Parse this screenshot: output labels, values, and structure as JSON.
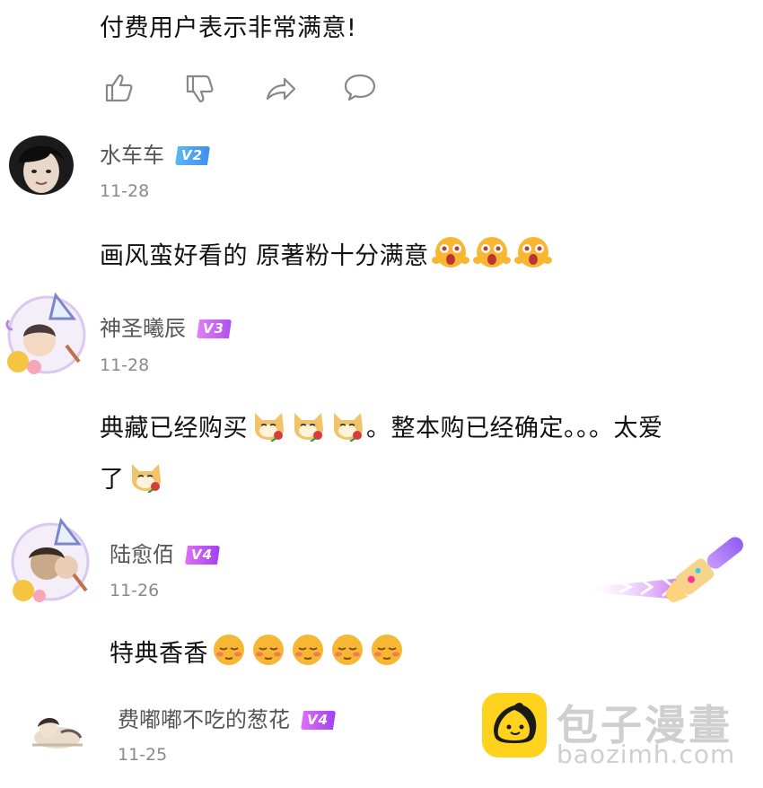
{
  "comments": [
    {
      "text": "付费用户表示非常满意!"
    },
    {
      "username": "水车车",
      "badge": "V2",
      "date": "11-28",
      "text": "画风蛮好看的 原著粉十分满意"
    },
    {
      "username": "神圣曦辰",
      "badge": "V3",
      "date": "11-28",
      "text_line1": "典藏已经购买",
      "text_line1b": "。整本购已经确定。。。太爱",
      "text_line2": "了"
    },
    {
      "username": "陆愈佰",
      "badge": "V4",
      "date": "11-26",
      "text": "特典香香"
    },
    {
      "username": "费嘟嘟不吃的葱花",
      "badge": "V4",
      "date": "11-25"
    }
  ],
  "actions": [
    {
      "icon": "thumbs-up-icon"
    },
    {
      "icon": "thumbs-down-icon"
    },
    {
      "icon": "share-icon"
    },
    {
      "icon": "comment-icon"
    }
  ],
  "emojis": {
    "shocked": "shocked-face-emoji",
    "dog_rose": "shiba-rose-emoji",
    "shy": "shy-face-emoji"
  },
  "watermark": {
    "title": "包子漫畫",
    "url": "baozimh.com"
  },
  "colors": {
    "badge_v2": "#4a9ff2",
    "badge_v3": "#c860f4",
    "badge_v4": "#b150f2",
    "watermark_logo": "#ffd21e"
  }
}
